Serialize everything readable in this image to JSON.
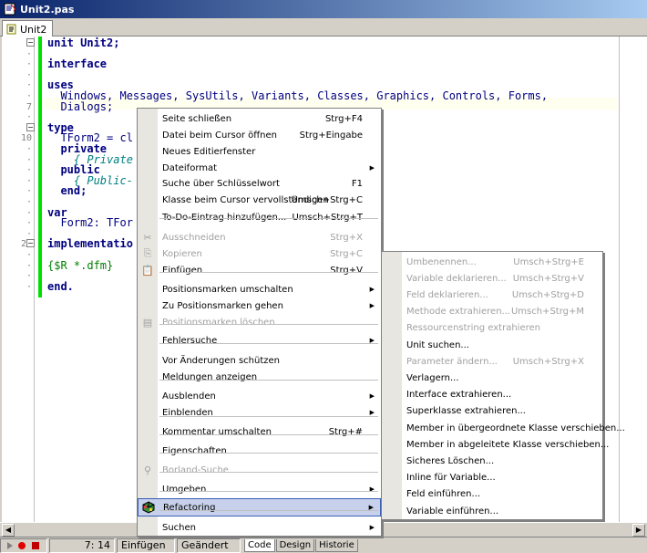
{
  "window": {
    "title": "Unit2.pas"
  },
  "tab": {
    "label": "Unit2"
  },
  "gutter_numbers": [
    "7",
    "10",
    "20"
  ],
  "code_lines": [
    "unit Unit2;",
    "",
    "interface",
    "",
    "uses",
    "  Windows, Messages, SysUtils, Variants, Classes, Graphics, Controls, Forms,",
    "  Dialogs;",
    "",
    "type",
    "  TForm2 = cl",
    "  private",
    "    { Private",
    "  public",
    "    { Public-",
    "  end;",
    "",
    "var",
    "  Form2: TFor",
    "",
    "implementatio",
    "",
    "{$R *.dfm}",
    "",
    "end."
  ],
  "context_menu": [
    {
      "label": "Seite schließen",
      "shortcut": "Strg+F4"
    },
    {
      "label": "Datei beim Cursor öffnen",
      "shortcut": "Strg+Eingabe"
    },
    {
      "label": "Neues Editierfenster",
      "shortcut": ""
    },
    {
      "label": "Dateiformat",
      "shortcut": ""
    },
    {
      "label": "Suche über Schlüsselwort",
      "shortcut": "F1"
    },
    {
      "label": "Klasse beim Cursor vervollständigen",
      "shortcut": "Umsch+Strg+C"
    },
    {
      "label": "To-Do-Eintrag hinzufügen...",
      "shortcut": "Umsch+Strg+T"
    },
    {
      "label": "Ausschneiden",
      "shortcut": "Strg+X"
    },
    {
      "label": "Kopieren",
      "shortcut": "Strg+C"
    },
    {
      "label": "Einfügen",
      "shortcut": "Strg+V"
    },
    {
      "label": "Positionsmarken umschalten",
      "shortcut": ""
    },
    {
      "label": "Zu Positionsmarken gehen",
      "shortcut": ""
    },
    {
      "label": "Positionsmarken löschen",
      "shortcut": ""
    },
    {
      "label": "Fehlersuche",
      "shortcut": ""
    },
    {
      "label": "Vor Änderungen schützen",
      "shortcut": ""
    },
    {
      "label": "Meldungen anzeigen",
      "shortcut": ""
    },
    {
      "label": "Ausblenden",
      "shortcut": ""
    },
    {
      "label": "Einblenden",
      "shortcut": ""
    },
    {
      "label": "Kommentar umschalten",
      "shortcut": "Strg+#"
    },
    {
      "label": "Eigenschaften",
      "shortcut": ""
    },
    {
      "label": "Borland-Suche",
      "shortcut": ""
    },
    {
      "label": "Umgeben",
      "shortcut": ""
    },
    {
      "label": "Refactoring",
      "shortcut": ""
    },
    {
      "label": "Suchen",
      "shortcut": ""
    }
  ],
  "refactoring_menu": [
    {
      "label": "Umbenennen...",
      "shortcut": "Umsch+Strg+E"
    },
    {
      "label": "Variable deklarieren...",
      "shortcut": "Umsch+Strg+V"
    },
    {
      "label": "Feld deklarieren...",
      "shortcut": "Umsch+Strg+D"
    },
    {
      "label": "Methode extrahieren...",
      "shortcut": "Umsch+Strg+M"
    },
    {
      "label": "Ressourcenstring extrahieren",
      "shortcut": ""
    },
    {
      "label": "Unit suchen...",
      "shortcut": ""
    },
    {
      "label": "Parameter ändern...",
      "shortcut": "Umsch+Strg+X"
    },
    {
      "label": "Verlagern...",
      "shortcut": ""
    },
    {
      "label": "Interface extrahieren...",
      "shortcut": ""
    },
    {
      "label": "Superklasse extrahieren...",
      "shortcut": ""
    },
    {
      "label": "Member in übergeordnete Klasse verschieben...",
      "shortcut": ""
    },
    {
      "label": "Member in abgeleitete Klasse verschieben...",
      "shortcut": ""
    },
    {
      "label": "Sicheres Löschen...",
      "shortcut": ""
    },
    {
      "label": "Inline für Variable...",
      "shortcut": ""
    },
    {
      "label": "Feld einführen...",
      "shortcut": ""
    },
    {
      "label": "Variable einführen...",
      "shortcut": ""
    }
  ],
  "status": {
    "position": "7: 14",
    "mode": "Einfügen",
    "modified": "Geändert",
    "view_tabs": [
      "Code",
      "Design",
      "Historie"
    ]
  },
  "colors": {
    "highlight": "#c7d1ec",
    "fold_bar": "#00e000",
    "code": "#000080",
    "comment": "#008080"
  }
}
